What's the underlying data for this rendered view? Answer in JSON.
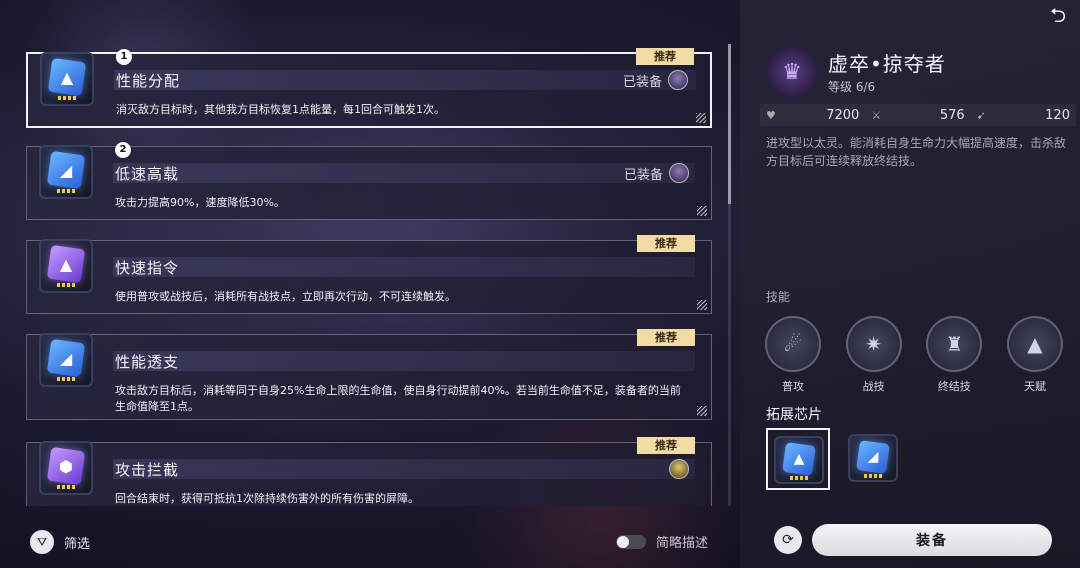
{
  "chips": [
    {
      "order": "1",
      "title": "性能分配",
      "desc": "消灭敌方目标时，其他我方目标恢复1点能量，每1回合可触发1次。",
      "badge": "推荐",
      "equipped": "已装备",
      "color": "blue",
      "glyph": "▲"
    },
    {
      "order": "2",
      "title": "低速高载",
      "desc": "攻击力提高90%，速度降低30%。",
      "badge": "",
      "equipped": "已装备",
      "color": "blue",
      "glyph": "◢"
    },
    {
      "order": "",
      "title": "快速指令",
      "desc": "使用普攻或战技后，消耗所有战技点，立即再次行动，不可连续触发。",
      "badge": "推荐",
      "equipped": "",
      "color": "purple",
      "glyph": "▲"
    },
    {
      "order": "",
      "title": "性能透支",
      "desc": "攻击敌方目标后，消耗等同于自身25%生命上限的生命值，使自身行动提前40%。若当前生命值不足，装备者的当前生命值降至1点。",
      "badge": "推荐",
      "equipped": "",
      "color": "blue",
      "glyph": "◢"
    },
    {
      "order": "",
      "title": "攻击拦截",
      "desc": "回合结束时，获得可抵抗1次除持续伤害外的所有伤害的屏障。",
      "badge": "推荐",
      "equipped": "",
      "color": "purple",
      "glyph": "⬢"
    }
  ],
  "filter": {
    "label": "筛选",
    "icon": "filter-icon"
  },
  "brief": {
    "label": "简略描述",
    "on": false
  },
  "character": {
    "name": "虚卒•掠夺者",
    "level": "等级 6/6",
    "stats": [
      {
        "icon": "heart-icon",
        "value": "7200"
      },
      {
        "icon": "sword-icon",
        "value": "576"
      },
      {
        "icon": "speed-icon",
        "value": "120"
      }
    ],
    "desc": "进攻型以太灵。能消耗自身生命力大幅提高速度，击杀敌方目标后可连续释放终结技。"
  },
  "skills_title": "技能",
  "skills": [
    {
      "label": "普攻",
      "icon": "comet-icon"
    },
    {
      "label": "战技",
      "icon": "burst-icon"
    },
    {
      "label": "终结技",
      "icon": "helmet-icon"
    },
    {
      "label": "天赋",
      "icon": "triangle-icon"
    }
  ],
  "chip_section_title": "拓展芯片",
  "equip_label": "装备",
  "colors": {
    "badge": "#f2dba5",
    "chip_blue": "#2a5fd8",
    "chip_purple": "#6a3bd0"
  }
}
